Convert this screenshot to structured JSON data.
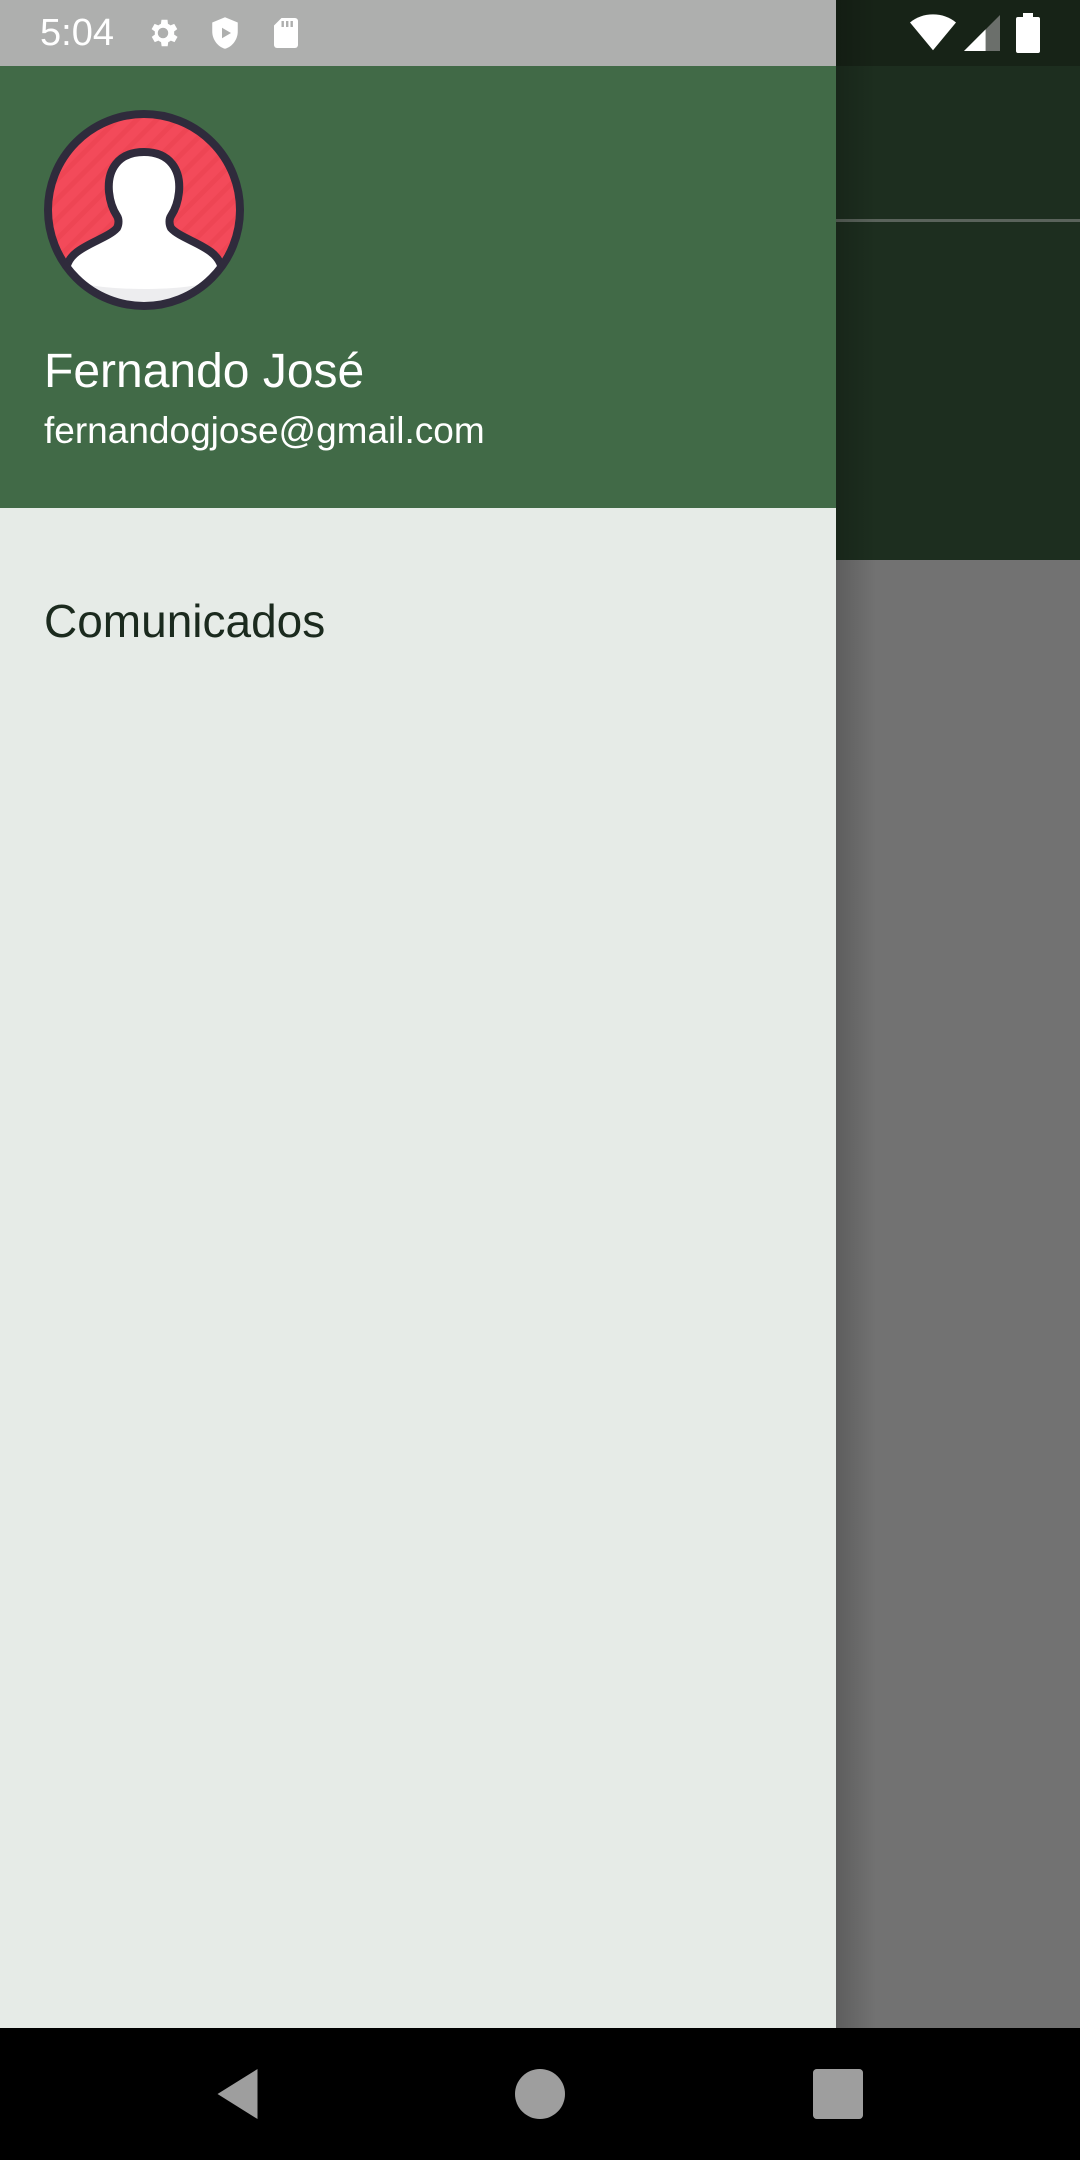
{
  "status_bar": {
    "time": "5:04",
    "left_icons": [
      "gear-icon",
      "shield-icon",
      "sd-card-icon"
    ],
    "right_icons": [
      "wifi-icon",
      "cell-signal-icon",
      "battery-icon"
    ]
  },
  "drawer": {
    "user": {
      "name": "Fernando José",
      "email": "fernandogjose@gmail.com"
    },
    "menu": [
      {
        "label": "Comunicados"
      }
    ]
  },
  "nav_bar": {
    "buttons": [
      "back-icon",
      "home-icon",
      "recents-icon"
    ]
  },
  "colors": {
    "drawer_header": "#416a47",
    "drawer_body": "#e6ebe7",
    "status_bar_left": "#aeafae",
    "background_toolbar": "#1d2e1f",
    "scrim": "#727272",
    "avatar_ring": "#f1475a"
  }
}
